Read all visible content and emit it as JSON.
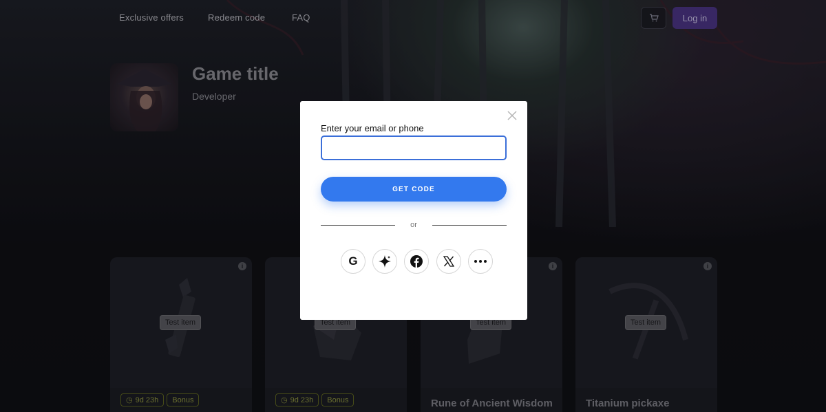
{
  "nav": {
    "links": [
      "Exclusive offers",
      "Redeem code",
      "FAQ"
    ],
    "cart_icon": "cart-icon",
    "login_label": "Log in"
  },
  "game": {
    "title": "Game title",
    "developer": "Developer"
  },
  "cards": [
    {
      "tag": "Test item",
      "badges": [
        "9d 23h",
        "Bonus"
      ],
      "name": ""
    },
    {
      "tag": "Test item",
      "badges": [
        "9d 23h",
        "Bonus"
      ],
      "name": ""
    },
    {
      "tag": "Test item",
      "badges": [],
      "name": "Rune of Ancient Wisdom"
    },
    {
      "tag": "Test item",
      "badges": [],
      "name": "Titanium pickaxe"
    }
  ],
  "modal": {
    "label": "Enter your email or phone",
    "input_value": "",
    "input_placeholder": "",
    "cta_label": "GET CODE",
    "divider_text": "or",
    "social_icons": [
      "google-icon",
      "sparkle-icon",
      "facebook-icon",
      "x-icon",
      "more-icon"
    ]
  },
  "colors": {
    "accent": "#3379ee",
    "login_bg": "#4b3484",
    "badge": "#8f9640"
  }
}
